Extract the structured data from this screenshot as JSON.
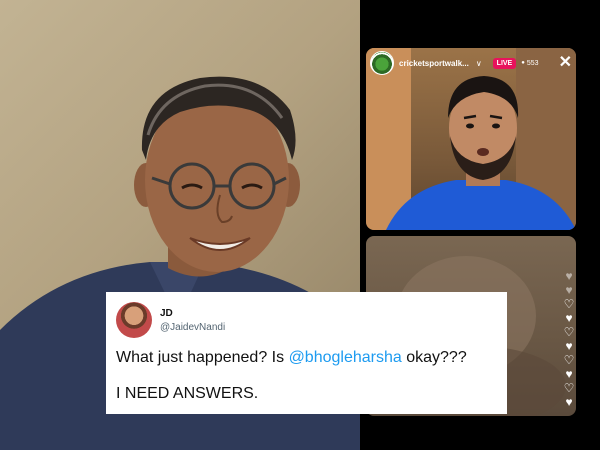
{
  "left_photo": {
    "description_icon": "smiling-man-photo"
  },
  "ig_live": {
    "username": "cricketsportwalk...",
    "live_badge": "LIVE",
    "viewer_count": "553",
    "close_glyph": "✕",
    "chevron_glyph": "∨",
    "viewer_glyph": "👁"
  },
  "tweet": {
    "display_name": "JD",
    "handle": "@JaidevNandi",
    "text_before": "What just happened? Is ",
    "mention": "@bhogleharsha",
    "text_after": " okay???",
    "text_line2": "I NEED ANSWERS."
  },
  "colors": {
    "live_badge": "#e8125c",
    "mention": "#1d9bf0"
  }
}
